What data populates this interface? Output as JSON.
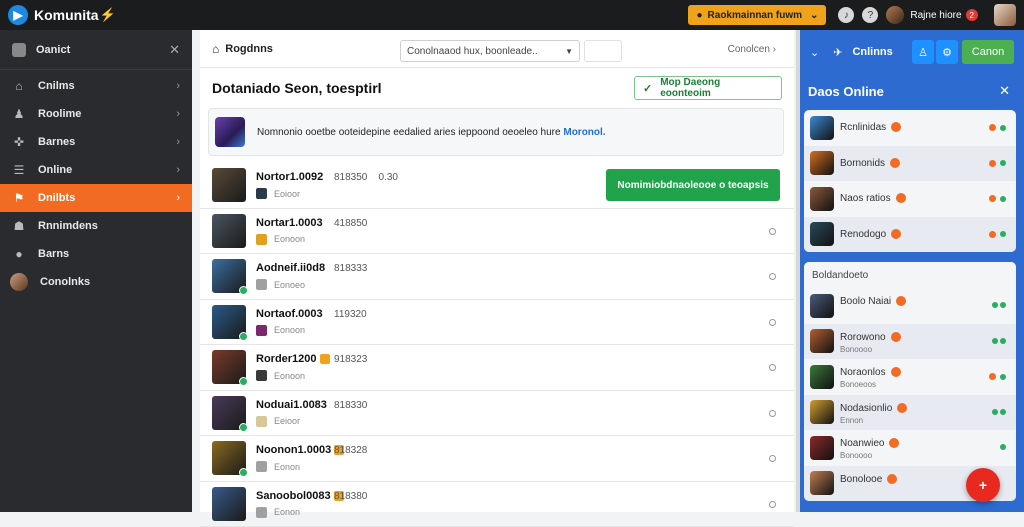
{
  "app": {
    "brand": "Komunita"
  },
  "topbar": {
    "promo_label": "Raokmainnan fuwm",
    "user_name": "Rajne hiore",
    "badge": "2"
  },
  "sidebar": {
    "header": "Oanict",
    "items": [
      {
        "label": "Cnilms",
        "icon": "home-icon"
      },
      {
        "label": "Roolime",
        "icon": "user-icon"
      },
      {
        "label": "Barnes",
        "icon": "gamepad-icon"
      },
      {
        "label": "Online",
        "icon": "list-icon"
      },
      {
        "label": "Dnilbts",
        "icon": "flag-icon",
        "active": true
      },
      {
        "label": "Rnnimdens",
        "icon": "people-icon"
      },
      {
        "label": "Barns",
        "icon": "globe-icon"
      },
      {
        "label": "Conolnks",
        "icon": "avatar"
      }
    ]
  },
  "main": {
    "breadcrumb": "Rogdnns",
    "filter_value": "Conolnaaod hux, boonleade..",
    "right_link": "Conolcen",
    "section_title": "Dotaniado Seon, toesptirl",
    "map_button": "Mop Daeong eoonteoim",
    "info_text": "Nomnonio ooetbe ooteidepine eedalied aries ieppoond oeoeleo hure",
    "info_link": "Moronol.",
    "action_button": "Nomimiobdnaoleooe o teoapsis",
    "rows": [
      {
        "name": "Nortor1.0092",
        "score": "818350",
        "extra": "0.30",
        "sub": "Eoioor",
        "gc": "#2b3a4a",
        "ac": "#5a4a38",
        "online": false
      },
      {
        "name": "Nortar1.0003",
        "score": "418850",
        "sub": "Eonoon",
        "gc": "#e0a020",
        "ac": "#4a5560",
        "online": false
      },
      {
        "name": "Aodneif.ii0d8",
        "score": "818333",
        "sub": "Eonoeo",
        "gc": "#a0a0a0",
        "ac": "#3a6fa0",
        "online": true
      },
      {
        "name": "Nortaof.0003",
        "score": "119320",
        "sub": "Eonoon",
        "gc": "#7a2a6a",
        "ac": "#2a5a8a",
        "online": true
      },
      {
        "name": "Rorder1200",
        "score": "918323",
        "sub": "Eonoon",
        "gc": "#3a3a3a",
        "ac": "#7a3a2a",
        "online": true,
        "warn": true
      },
      {
        "name": "Noduai1.0083",
        "score": "818330",
        "sub": "Eeioor",
        "gc": "#d8c898",
        "ac": "#4a3a5a",
        "online": true
      },
      {
        "name": "Noonon1.0003",
        "score": "818328",
        "sub": "Eonon",
        "gc": "#a0a0a0",
        "ac": "#8a6a20",
        "online": true,
        "warn": true
      },
      {
        "name": "Sanoobol0083",
        "score": "818380",
        "sub": "Eonon",
        "gc": "#a0a0a0",
        "ac": "#3a5a8a",
        "online": false,
        "warn": true
      }
    ]
  },
  "right_panel": {
    "tab_label": "Cnlinns",
    "button_label": "Canon",
    "title": "Daos Online",
    "card1": [
      {
        "name": "Rcnlinidas",
        "ac": "#3a8ad0"
      },
      {
        "name": "Bornonids",
        "ac": "#d07020"
      },
      {
        "name": "Naos ratios",
        "ac": "#8a5a3a"
      },
      {
        "name": "Renodogo",
        "ac": "#2a4a5a"
      }
    ],
    "card2_title": "Boldandoeto",
    "card2": [
      {
        "name": "Boolo Naiai",
        "sub": "",
        "ac": "#4a5a7a",
        "status": "gg"
      },
      {
        "name": "Rorowono",
        "sub": "Bonoooo",
        "ac": "#b06030",
        "status": "gg"
      },
      {
        "name": "Noraonlos",
        "sub": "Bonoeoos",
        "ac": "#3a7a3a",
        "status": "og"
      },
      {
        "name": "Nodasionlio",
        "sub": "Ennon",
        "ac": "#d0a030",
        "status": "gg"
      },
      {
        "name": "Noanwieo",
        "sub": "Bonoooo",
        "ac": "#8a2a2a",
        "status": "g"
      },
      {
        "name": "Bonolooe",
        "sub": "",
        "ac": "#c08050",
        "status": ""
      }
    ]
  }
}
